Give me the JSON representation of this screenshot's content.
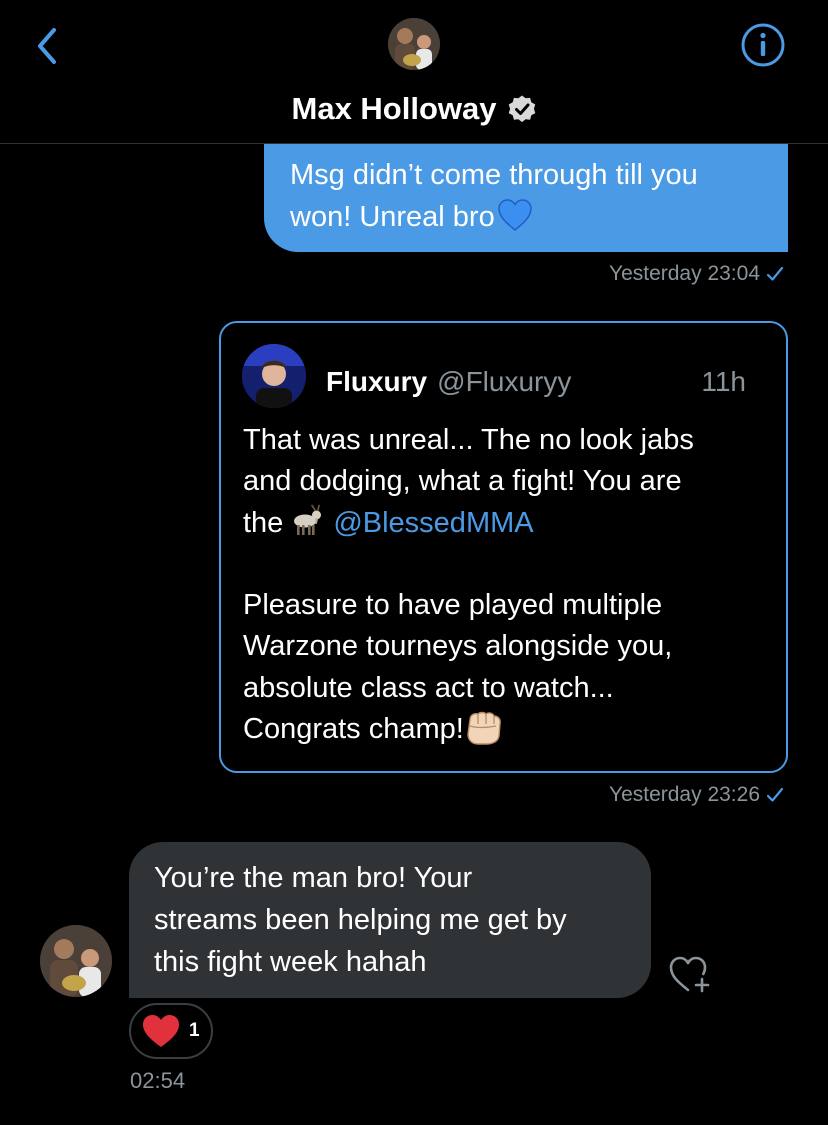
{
  "header": {
    "back_icon": "chevron-left-icon",
    "info_icon": "info-circle-icon",
    "contact_name": "Max Holloway",
    "verified_icon": "verified-badge-icon"
  },
  "messages": [
    {
      "direction": "sent",
      "text_line1": "Msg didn’t come through till you",
      "text_line2": "won! Unreal bro",
      "emoji": "blue-heart",
      "timestamp": "Yesterday 23:04",
      "status_icon": "checkmark-icon"
    },
    {
      "direction": "sent",
      "type": "shared-tweet",
      "tweet": {
        "author": "Fluxury",
        "handle": "@Fluxuryy",
        "time": "11h",
        "line1": "That was unreal... The no look jabs",
        "line2": "and dodging, what a fight! You are",
        "line3_prefix": "the",
        "line3_emoji": "goat",
        "mention": "@BlessedMMA",
        "line4": "Pleasure to have played multiple",
        "line5": "Warzone tourneys alongside you,",
        "line6": "absolute class act to watch...",
        "line7": "Congrats champ!",
        "line7_emoji": "fist-bump"
      },
      "timestamp": "Yesterday 23:26",
      "status_icon": "checkmark-icon"
    },
    {
      "direction": "received",
      "line1": "You’re the man bro! Your",
      "line2": "streams been helping me get by",
      "line3": "this fight week hahah",
      "reaction_emoji": "red-heart",
      "reaction_count": "1",
      "timestamp": "02:54"
    }
  ],
  "colors": {
    "background": "#000000",
    "accent": "#4a9ae6",
    "received_bubble": "#2f3336",
    "secondary_text": "#8b949a"
  }
}
